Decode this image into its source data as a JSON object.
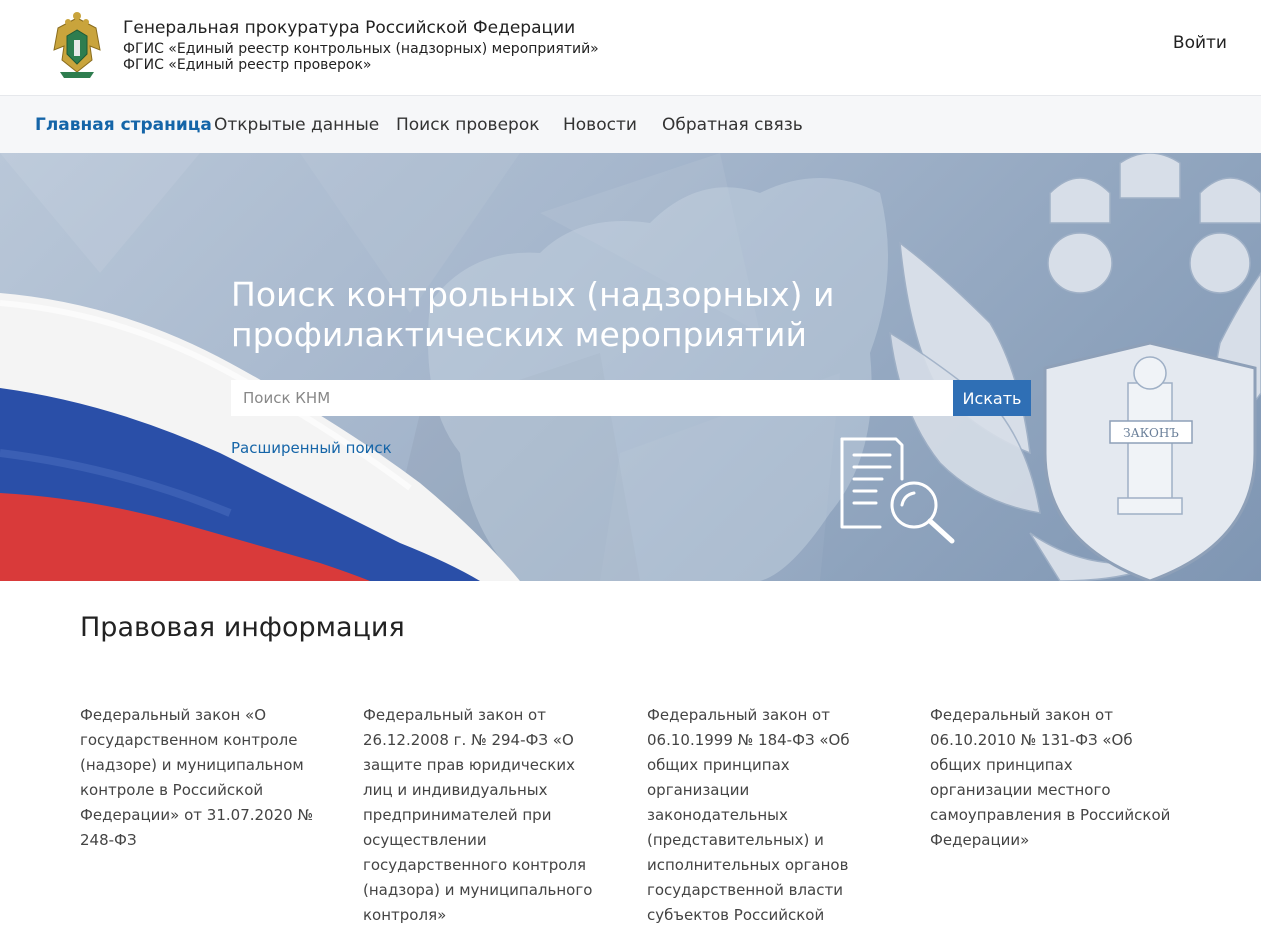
{
  "header": {
    "org_title": "Генеральная прокуратура Российской Федерации",
    "subtitle_1": "ФГИС «Единый реестр контрольных (надзорных) мероприятий»",
    "subtitle_2": "ФГИС «Единый реестр проверок»",
    "login_label": "Войти"
  },
  "nav": {
    "items": [
      {
        "label": "Главная страница",
        "active": true
      },
      {
        "label": "Открытые данные"
      },
      {
        "label": "Поиск проверок"
      },
      {
        "label": "Новости"
      },
      {
        "label": "Обратная связь"
      }
    ]
  },
  "hero": {
    "title": "Поиск контрольных (надзорных) и профилактических мероприятий",
    "search_placeholder": "Поиск КНМ",
    "search_value": "",
    "search_button": "Искать",
    "advanced_link": "Расширенный поиск",
    "crest_text": "ЗАКОНЪ"
  },
  "legal": {
    "heading": "Правовая информация",
    "laws": [
      {
        "text": "Федеральный закон «О государственном контроле (надзоре) и муниципальном контроле в Российской Федерации» от 31.07.2020 № 248-ФЗ"
      },
      {
        "text": "Федеральный закон от 26.12.2008 г. № 294-ФЗ «О защите прав юридических лиц и индивидуальных предпринимателей при осуществлении государственного контроля (надзора) и муниципального контроля»"
      },
      {
        "text": "Федеральный закон от 06.10.1999 № 184-ФЗ «Об общих принципах организации законодательных (представительных) и исполнительных органов государственной власти субъектов Российской Федерации»"
      },
      {
        "text": "Федеральный закон от 06.10.2010 № 131-ФЗ «Об общих принципах организации местного самоуправления в Российской Федерации»"
      }
    ]
  },
  "colors": {
    "accent": "#1565a8",
    "button": "#2f6fb5",
    "flag_white": "#f4f4f4",
    "flag_blue": "#2a4fa8",
    "flag_red": "#d93a3a"
  }
}
